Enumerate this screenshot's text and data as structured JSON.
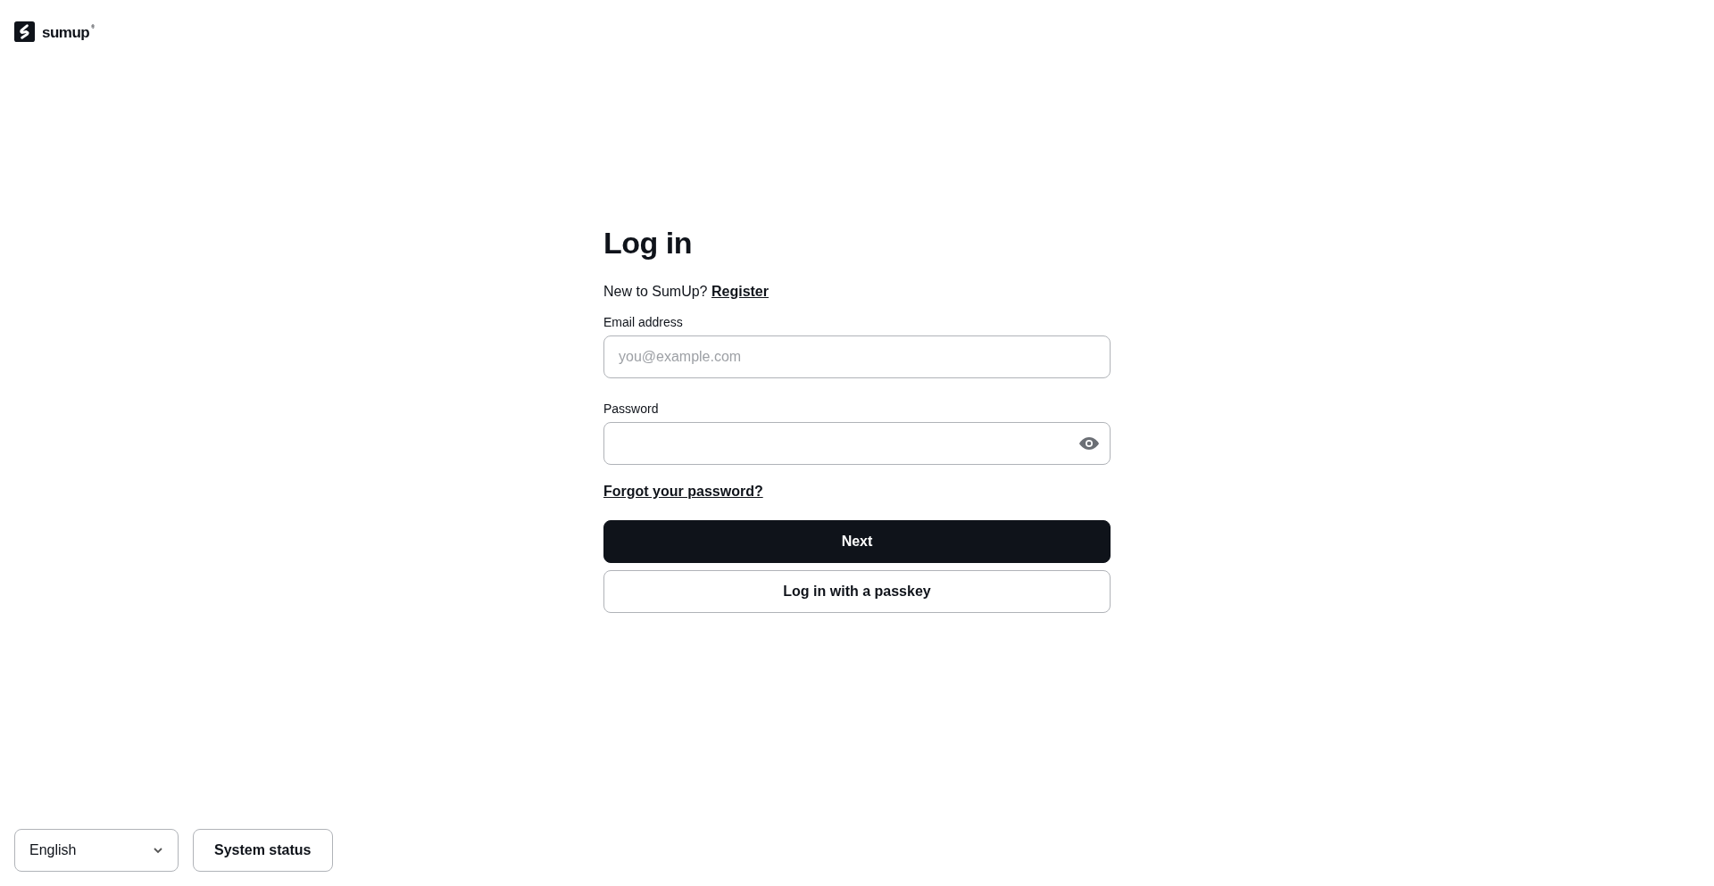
{
  "logo": {
    "wordmark": "sumup",
    "mark": "®"
  },
  "title": "Log in",
  "register_prompt": {
    "text": "New to SumUp?",
    "link": "Register"
  },
  "fields": [
    {
      "kind": "email",
      "label": "Email address",
      "placeholder": "you@example.com"
    },
    {
      "kind": "password",
      "label": "Password"
    }
  ],
  "forgot_link": "Forgot your password?",
  "buttons": [
    {
      "kind": "primary",
      "label": "Next"
    },
    {
      "kind": "secondary",
      "label": "Log in with a passkey"
    }
  ],
  "footer": {
    "language": "English",
    "status_button": "System status"
  }
}
